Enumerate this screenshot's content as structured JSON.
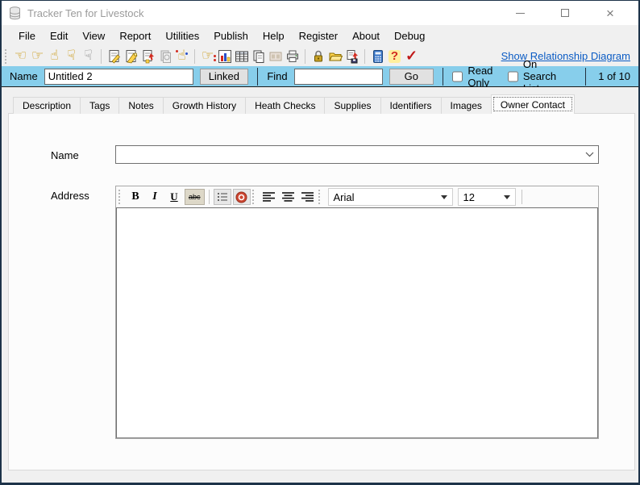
{
  "window": {
    "title": "Tracker Ten for Livestock",
    "controls": {
      "minimize": "minimize",
      "maximize": "maximize",
      "close": "×"
    }
  },
  "menu": {
    "items": [
      "File",
      "Edit",
      "View",
      "Report",
      "Utilities",
      "Publish",
      "Help",
      "Register",
      "About",
      "Debug"
    ]
  },
  "toolbar": {
    "icons": [
      "hand-point-left",
      "hand-point-right",
      "hand-point-up",
      "hand-point-down",
      "hand-point-down-outline",
      "edit-record-page-pencil",
      "sign-page-pencil",
      "save-page-red-arrow",
      "copy-page-disabled",
      "hand-sparkle",
      "goto-hand-dots",
      "bar-chart",
      "table-grid",
      "copy-pages",
      "film-strip-disabled",
      "printer",
      "padlock",
      "open-folder",
      "export-save",
      "calculator",
      "help-question",
      "red-checkmark"
    ],
    "link_label": "Show Relationship Diagram"
  },
  "record_bar": {
    "name_label": "Name",
    "name_value": "Untitled 2",
    "linked_button": "Linked",
    "find_label": "Find",
    "find_value": "",
    "go_button": "Go",
    "read_only_label": "Read Only",
    "on_search_list_label": "On Search List",
    "record_counter": "1 of 10"
  },
  "tabs": {
    "items": [
      "Description",
      "Tags",
      "Notes",
      "Growth History",
      "Heath Checks",
      "Supplies",
      "Identifiers",
      "Images",
      "Owner Contact"
    ],
    "active": "Owner Contact"
  },
  "form": {
    "name_label": "Name",
    "name_value": "",
    "address_label": "Address"
  },
  "editor": {
    "bold": "B",
    "italic": "I",
    "underline": "U",
    "strike": "abc",
    "font_name": "Arial",
    "font_size": "12",
    "text": ""
  },
  "colors": {
    "record_bar_bg": "#87CEEB",
    "link_blue": "#0A5BC4",
    "window_border": "#1D3349",
    "help_red": "#D22B1F"
  }
}
